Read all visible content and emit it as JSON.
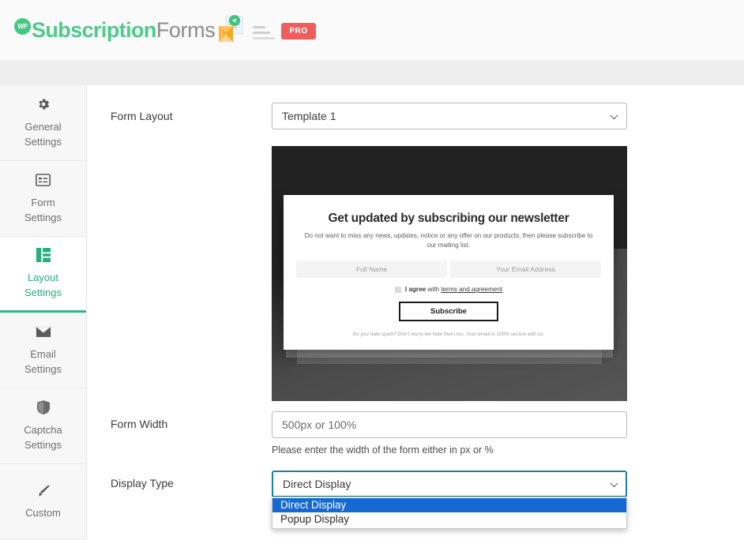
{
  "header": {
    "logo_badge": "WP",
    "logo_primary": "Subscription",
    "logo_secondary": "Forms",
    "pro_badge": "PRO",
    "mail_icon": "mail-envelope-icon",
    "lines_icon": "dash-lines-icon"
  },
  "sidebar": {
    "items": [
      {
        "label_line1": "General",
        "label_line2": "Settings",
        "icon": "gear-icon",
        "active": false
      },
      {
        "label_line1": "Form",
        "label_line2": "Settings",
        "icon": "form-list-icon",
        "active": false
      },
      {
        "label_line1": "Layout",
        "label_line2": "Settings",
        "icon": "layout-grid-icon",
        "active": true
      },
      {
        "label_line1": "Email",
        "label_line2": "Settings",
        "icon": "envelope-icon",
        "active": false
      },
      {
        "label_line1": "Captcha",
        "label_line2": "Settings",
        "icon": "shield-icon",
        "active": false
      },
      {
        "label_line1": "Custom",
        "label_line2": "",
        "icon": "brush-icon",
        "active": false
      }
    ]
  },
  "main": {
    "form_layout": {
      "label": "Form Layout",
      "value": "Template 1",
      "options": [
        "Template 1"
      ]
    },
    "preview": {
      "title": "Get updated by subscribing our newsletter",
      "subtitle": "Do not want to miss any news, updates, notice or any offer on our products, then please subscribe to our mailing list.",
      "name_placeholder": "Full Name",
      "email_placeholder": "Your Email Address",
      "agree_prefix": "I agree",
      "agree_middle": " with ",
      "agree_link": "terms and agreement",
      "button": "Subscribe",
      "footer": "Do you hate spam? Don't worry we hate them too. Your email is 100% secure with us."
    },
    "form_width": {
      "label": "Form Width",
      "placeholder": "500px or 100%",
      "value": "",
      "hint": "Please enter the width of the form either in px or %"
    },
    "display_type": {
      "label": "Display Type",
      "value": "Direct Display",
      "options": [
        "Direct Display",
        "Popup Display"
      ],
      "selected_index": 0
    }
  },
  "colors": {
    "brand_green": "#4ecb8c",
    "active_teal": "#22b07d",
    "pro_red": "#ef5d5d",
    "dropdown_highlight": "#1669d3",
    "focus_border": "#1b7fa8"
  }
}
